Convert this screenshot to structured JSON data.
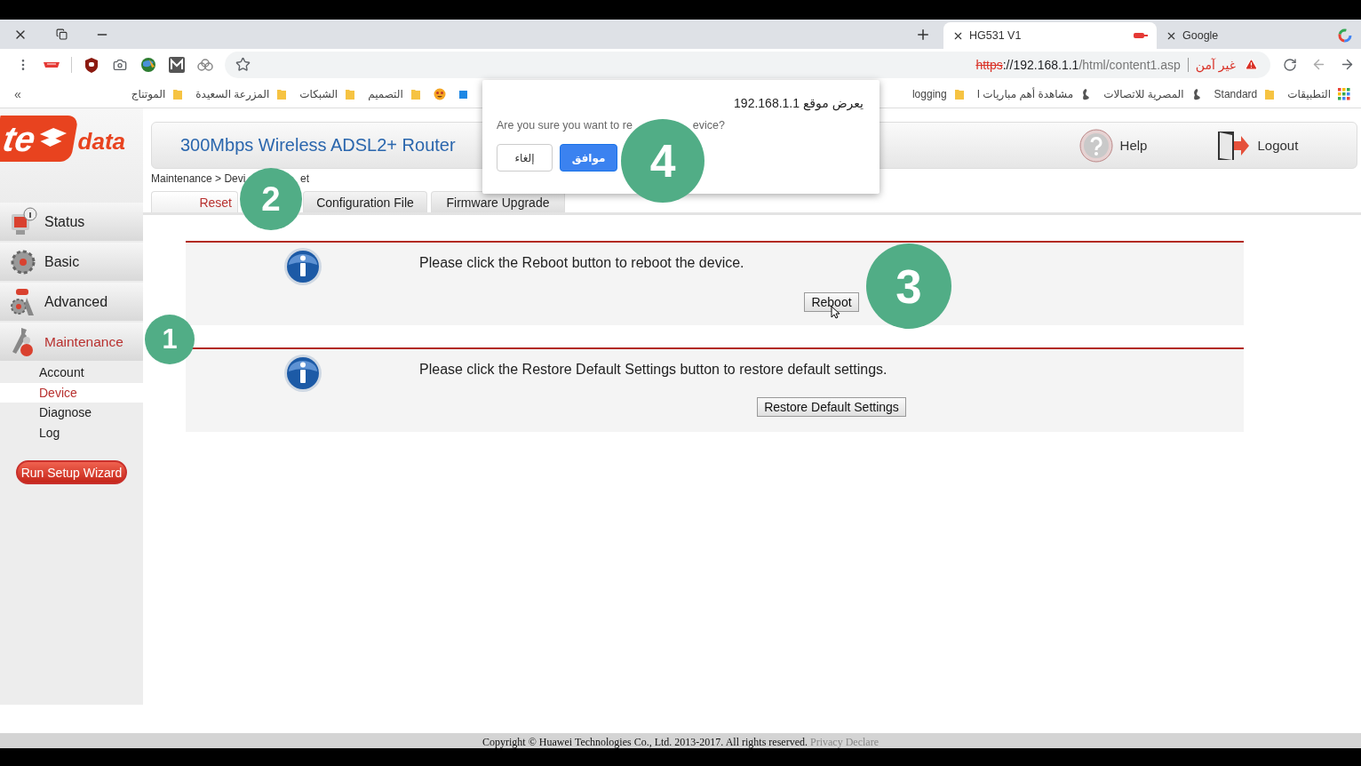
{
  "browser": {
    "tabs": [
      {
        "title": "HG531 V1",
        "selected": true
      },
      {
        "title": "Google",
        "selected": false
      }
    ],
    "address": {
      "scheme": "https",
      "host": "://192.168.1.1",
      "path": "/html/content1.asp",
      "security_label": "غير آمن"
    },
    "bookmarks": [
      {
        "kind": "apps",
        "label": "التطبيقات"
      },
      {
        "kind": "folder",
        "label": "Standard"
      },
      {
        "kind": "site",
        "label": "المصرية للاتصالات"
      },
      {
        "kind": "site",
        "label": "مشاهدة أهم مباريات ا"
      },
      {
        "kind": "folder",
        "label": "logging"
      },
      {
        "kind": "tile"
      },
      {
        "kind": "emoji"
      },
      {
        "kind": "folder",
        "label": "التصميم"
      },
      {
        "kind": "folder",
        "label": "الشبكات"
      },
      {
        "kind": "folder",
        "label": "المزرعة السعيدة"
      },
      {
        "kind": "folder",
        "label": "الموتناج"
      }
    ],
    "bookmarks_overflow": "»"
  },
  "dialog": {
    "title": "يعرض موقع 192.168.1.1",
    "message_parts": [
      "Are you sure you want to re",
      "evice?"
    ],
    "buttons": [
      {
        "label": "موافق",
        "primary": true
      },
      {
        "label": "إلغاء",
        "primary": false
      }
    ]
  },
  "router": {
    "logo": {
      "mark": "te",
      "word": "data"
    },
    "title": "300Mbps Wireless ADSL2+ Router",
    "header_links": [
      {
        "kind": "help",
        "label": "Help"
      },
      {
        "kind": "logout",
        "label": "Logout"
      }
    ],
    "nav": [
      {
        "kind": "status",
        "label": "Status",
        "selected": false
      },
      {
        "kind": "basic",
        "label": "Basic",
        "selected": false
      },
      {
        "kind": "advanced",
        "label": "Advanced",
        "selected": false
      },
      {
        "kind": "maintenance",
        "label": "Maintenance",
        "selected": true,
        "children": [
          {
            "label": "Account",
            "selected": false
          },
          {
            "label": "Device",
            "selected": true
          },
          {
            "label": "Diagnose",
            "selected": false
          },
          {
            "label": "Log",
            "selected": false
          }
        ]
      }
    ],
    "wizard_button": "Run Setup Wizard",
    "breadcrumb_parts": [
      "Maintenance > Devi",
      "et"
    ],
    "tabs": [
      {
        "label": "Reset",
        "selected": true
      },
      {
        "label": "Configuration File",
        "selected": false
      },
      {
        "label": "Firmware Upgrade",
        "selected": false
      }
    ],
    "sections": [
      {
        "message": "Please click the Reboot button to reboot the device.",
        "button": "Reboot",
        "pointer": true
      },
      {
        "message": "Please click the Restore Default Settings button to restore default settings.",
        "button": "Restore Default Settings",
        "pointer": false
      }
    ],
    "footer": {
      "text": "Copyright © Huawei Technologies Co., Ltd. 2013-2017. All rights reserved.",
      "link": "Privacy Declare"
    }
  },
  "markers": [
    {
      "label": "1"
    },
    {
      "label": "2"
    },
    {
      "label": "3"
    },
    {
      "label": "4"
    }
  ]
}
